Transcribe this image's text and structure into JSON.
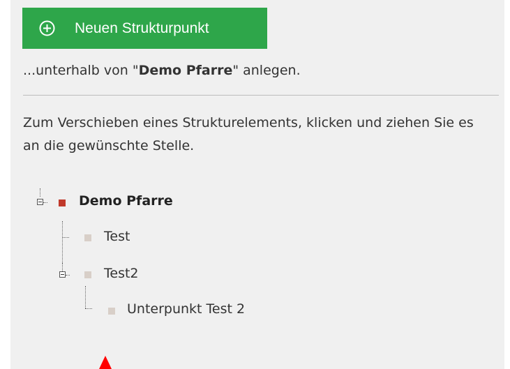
{
  "toolbar": {
    "new_item_label": "Neuen Strukturpunkt"
  },
  "helper": {
    "prefix": "...unterhalb von \"",
    "parent_name": "Demo Pfarre",
    "suffix": "\" anlegen."
  },
  "instructions": "Zum Verschieben eines Strukturelements, klicken und ziehen Sie es an die gewünschte Stelle.",
  "tree": {
    "root": {
      "label": "Demo Pfarre",
      "color": "#c0392b"
    },
    "children": [
      {
        "label": "Test"
      },
      {
        "label": "Test2",
        "children": [
          {
            "label": "Unterpunkt Test 2"
          }
        ]
      }
    ],
    "child_color": "#d8cfc8"
  },
  "colors": {
    "accent": "#2ea64a",
    "cursor": "#ff0000"
  }
}
